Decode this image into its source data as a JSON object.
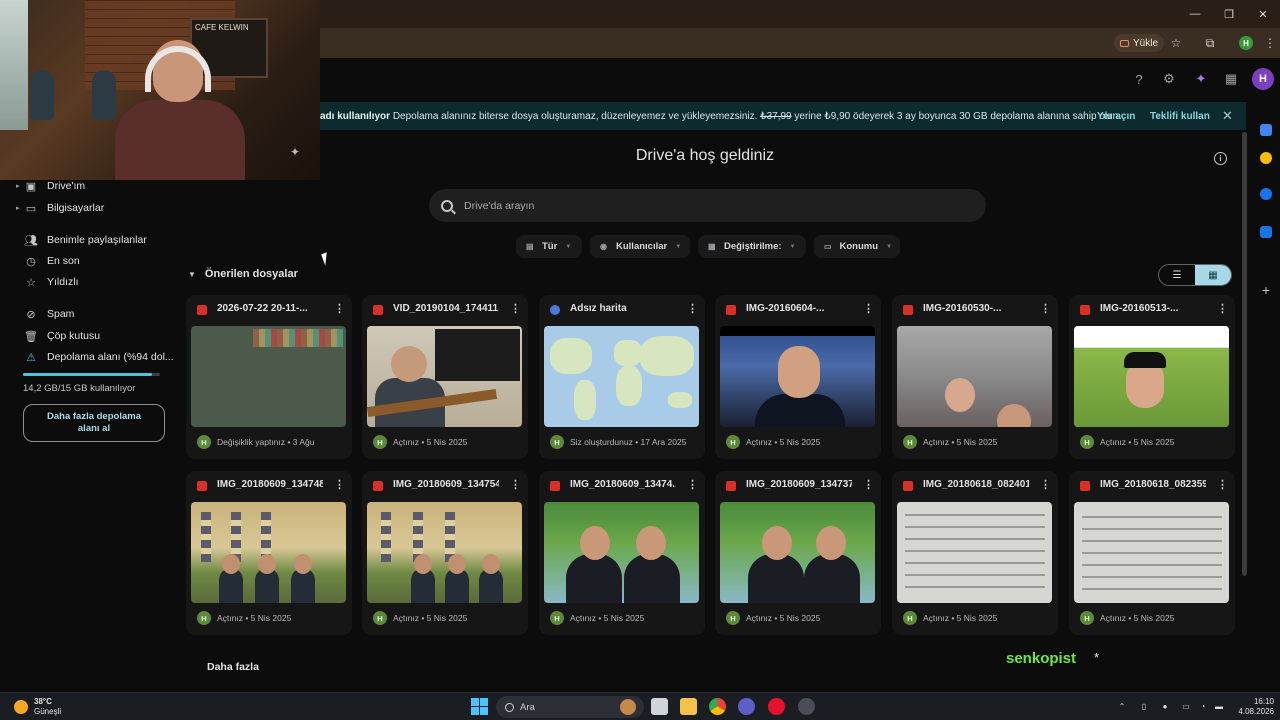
{
  "browser": {
    "upload_label": "Yükle",
    "profile_initial": "H"
  },
  "drive": {
    "avatar_initial": "H",
    "banner": {
      "lead": "adı kullanılıyor",
      "text": "Depolama alanınız biterse dosya oluşturamaz, düzenleyemez ve yükleyemezsiniz.",
      "old_price": "₺37,99",
      "rest": "yerine ₺9,90 ödeyerek 3 ay boyunca 30 GB depolama alanına sahip olun.",
      "action_open": "Yer açın",
      "action_free": "Teklifi kullan"
    },
    "welcome": "Drive'a hoş geldiniz",
    "search_placeholder": "Drive'da arayın",
    "filters": [
      "Tür",
      "Kullanıcılar",
      "Değiştirilme:",
      "Konumu"
    ],
    "sidebar": {
      "items": [
        {
          "label": "Drive'ım",
          "icon": "drive-icon"
        },
        {
          "label": "Bilgisayarlar",
          "icon": "computer-icon"
        },
        {
          "label": "Benimle paylaşılanlar",
          "icon": "people-icon"
        },
        {
          "label": "En son",
          "icon": "clock-icon"
        },
        {
          "label": "Yıldızlı",
          "icon": "star-icon"
        },
        {
          "label": "Spam",
          "icon": "spam-icon"
        },
        {
          "label": "Çöp kutusu",
          "icon": "trash-icon"
        },
        {
          "label": "Depolama alanı (%94 dol...",
          "icon": "warning-icon"
        }
      ],
      "storage_fraction": 0.94,
      "storage_text": "14,2 GB/15 GB kullanılıyor",
      "more_storage": "Daha fazla depolama alanı al"
    },
    "suggested_title": "Önerilen dosyalar",
    "files": [
      {
        "name": "2026-07-22 20-11-...",
        "type": "video",
        "meta": "Değişiklik yaptınız • 3 Ağu"
      },
      {
        "name": "VID_20190104_174411....",
        "type": "video",
        "meta": "Açtınız • 5 Nis 2025"
      },
      {
        "name": "Adsız harita",
        "type": "map",
        "meta": "Siz oluşturdunuz • 17 Ara 2025"
      },
      {
        "name": "IMG-20160604-...",
        "type": "image",
        "meta": "Açtınız • 5 Nis 2025"
      },
      {
        "name": "IMG-20160530-...",
        "type": "image",
        "meta": "Açtınız • 5 Nis 2025"
      },
      {
        "name": "IMG-20160513-...",
        "type": "image",
        "meta": "Açtınız • 5 Nis 2025"
      },
      {
        "name": "IMG_20180609_134748...",
        "type": "image",
        "meta": "Açtınız • 5 Nis 2025"
      },
      {
        "name": "IMG_20180609_134754...",
        "type": "image",
        "meta": "Açtınız • 5 Nis 2025"
      },
      {
        "name": "IMG_20180609_13474...",
        "type": "image",
        "meta": "Açtınız • 5 Nis 2025"
      },
      {
        "name": "IMG_20180609_134737...",
        "type": "image",
        "meta": "Açtınız • 5 Nis 2025"
      },
      {
        "name": "IMG_20180618_082401...",
        "type": "image",
        "meta": "Açtınız • 5 Nis 2025"
      },
      {
        "name": "IMG_20180618_082359...",
        "type": "image",
        "meta": "Açtınız • 5 Nis 2025"
      }
    ],
    "owner_initial": "H",
    "more_link": "Daha fazla"
  },
  "overlay": {
    "watermark": "senkopist",
    "watermark_mark": "*",
    "cafe_sign": "CAFE KELWIN"
  },
  "taskbar": {
    "weather_temp": "38°C",
    "weather_text": "Güneşli",
    "search_label": "Ara",
    "time": "16:10",
    "date": "4.08.2026"
  }
}
